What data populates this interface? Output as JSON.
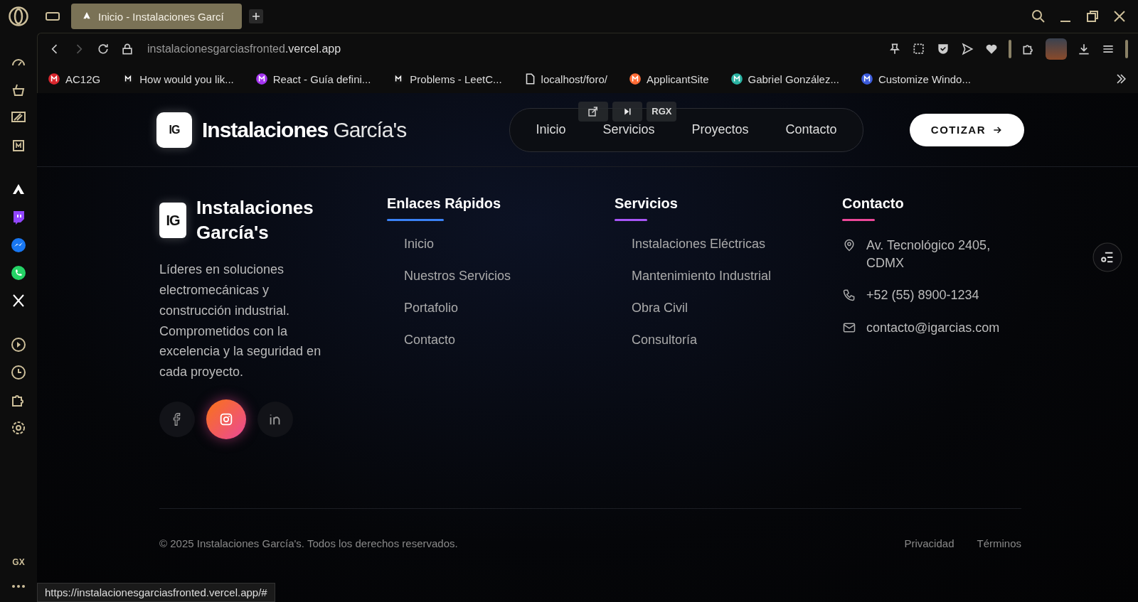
{
  "browser": {
    "tab_title": "Inicio - Instalaciones Garcí",
    "url_host": "instalacionesgarciasfronted",
    "url_domain": ".vercel.app",
    "bookmarks": [
      {
        "label": "AC12G",
        "kind": "mega"
      },
      {
        "label": "How would you lik...",
        "kind": "upwork"
      },
      {
        "label": "React - Guía defini...",
        "kind": "udemy"
      },
      {
        "label": "Problems - LeetC...",
        "kind": "leetcode"
      },
      {
        "label": "localhost/foro/",
        "kind": "page"
      },
      {
        "label": "ApplicantSite",
        "kind": "applicant"
      },
      {
        "label": "Gabriel González...",
        "kind": "sheet"
      },
      {
        "label": "Customize Windo...",
        "kind": "vs"
      }
    ],
    "sidebar_badge": "GX",
    "status_url": "https://instalacionesgarciasfronted.vercel.app/#"
  },
  "header": {
    "logo_mark": "IG",
    "brand_bold": "Instalaciones",
    "brand_light": "García's",
    "nav": [
      "Inicio",
      "Servicios",
      "Proyectos",
      "Contacto"
    ],
    "video_overlay_label": "RGX",
    "cta": "COTIZAR"
  },
  "footer": {
    "logo_mark": "IG",
    "brand": "Instalaciones García's",
    "description": "Líderes en soluciones electromecánicas y construcción industrial. Comprometidos con la excelencia y la seguridad en cada proyecto.",
    "social": [
      {
        "kind": "facebook",
        "highlighted": false
      },
      {
        "kind": "instagram",
        "highlighted": true
      },
      {
        "kind": "linkedin",
        "highlighted": false
      }
    ],
    "columns": [
      {
        "title": "Enlaces Rápidos",
        "color": "#3b82f6",
        "links": [
          "Inicio",
          "Nuestros Servicios",
          "Portafolio",
          "Contacto"
        ]
      },
      {
        "title": "Servicios",
        "color": "#a855f7",
        "links": [
          "Instalaciones Eléctricas",
          "Mantenimiento Industrial",
          "Obra Civil",
          "Consultoría"
        ]
      }
    ],
    "contact": {
      "title": "Contacto",
      "color": "#ec4899",
      "items": [
        {
          "kind": "location",
          "text": "Av. Tecnológico 2405, CDMX"
        },
        {
          "kind": "phone",
          "text": "+52 (55) 8900-1234"
        },
        {
          "kind": "email",
          "text": "contacto@igarcias.com"
        }
      ]
    },
    "copyright": "© 2025 Instalaciones García's. Todos los derechos reservados.",
    "legal_links": [
      "Privacidad",
      "Términos"
    ]
  }
}
